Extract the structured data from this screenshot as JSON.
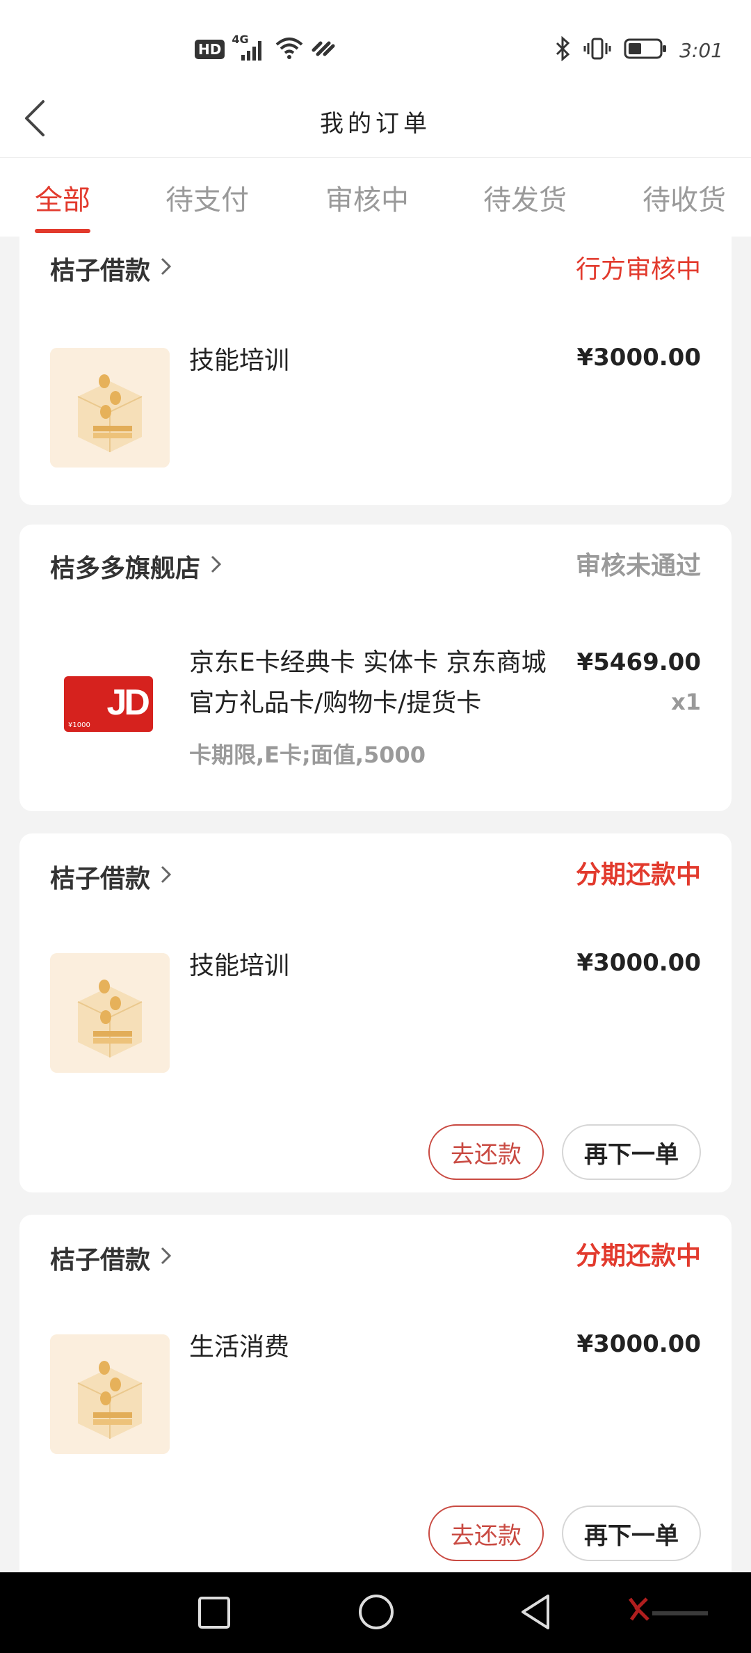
{
  "status_bar": {
    "hd": "HD",
    "net": "4G",
    "time": "3:01"
  },
  "header": {
    "title": "我的订单"
  },
  "tabs": [
    {
      "label": "全部",
      "active": true
    },
    {
      "label": "待支付",
      "active": false
    },
    {
      "label": "审核中",
      "active": false
    },
    {
      "label": "待发货",
      "active": false
    },
    {
      "label": "待收货",
      "active": false
    }
  ],
  "orders": [
    {
      "store": "桔子借款",
      "status": "行方审核中",
      "status_color": "#e23a2d",
      "product": "技能培训",
      "price": "¥3000.00"
    },
    {
      "store": "桔多多旗舰店",
      "status": "审核未通过",
      "status_color": "#9a9a9a",
      "product_line1": "京东E卡经典卡 实体卡 京东商城",
      "product_line2": "官方礼品卡/购物卡/提货卡",
      "price": "¥5469.00",
      "qty": "x1",
      "spec": "卡期限,E卡;面值,5000",
      "thumb_logo": "JD",
      "thumb_value": "¥1000"
    },
    {
      "store": "桔子借款",
      "status": "分期还款中",
      "status_color": "#e23a2d",
      "product": "技能培训",
      "price": "¥3000.00",
      "btn_repay": "去还款",
      "btn_reorder": "再下一单"
    },
    {
      "store": "桔子借款",
      "status": "分期还款中",
      "status_color": "#e23a2d",
      "product": "生活消费",
      "price": "¥3000.00",
      "btn_repay": "去还款",
      "btn_reorder": "再下一单"
    }
  ],
  "icons": {
    "back": "back-arrow-icon",
    "chevron": "chevron-right-icon",
    "nav_recent": "square-icon",
    "nav_home": "circle-icon",
    "nav_back": "triangle-back-icon"
  }
}
